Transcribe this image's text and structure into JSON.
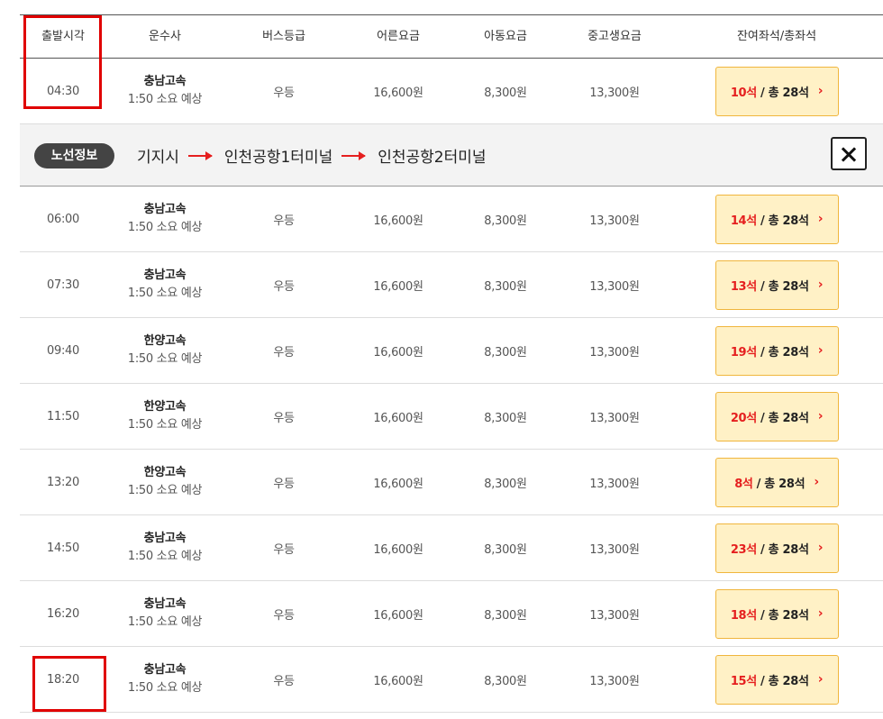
{
  "headers": {
    "time": "출발시각",
    "company": "운수사",
    "grade": "버스등급",
    "adult": "어른요금",
    "child": "아동요금",
    "teen": "중고생요금",
    "seats": "잔여좌석/총좌석"
  },
  "route_info": {
    "label": "노선정보",
    "stops": [
      "기지시",
      "인천공항1터미널",
      "인천공항2터미널"
    ]
  },
  "seat_suffix": "석",
  "total_prefix": "/ 총 ",
  "rows": [
    {
      "time": "04:30",
      "company": "충남고속",
      "duration": "1:50 소요 예상",
      "grade": "우등",
      "adult": "16,600원",
      "child": "8,300원",
      "teen": "13,300원",
      "remaining": "10석",
      "total": "/ 총 28석"
    },
    {
      "time": "06:00",
      "company": "충남고속",
      "duration": "1:50 소요 예상",
      "grade": "우등",
      "adult": "16,600원",
      "child": "8,300원",
      "teen": "13,300원",
      "remaining": "14석",
      "total": "/ 총 28석"
    },
    {
      "time": "07:30",
      "company": "충남고속",
      "duration": "1:50 소요 예상",
      "grade": "우등",
      "adult": "16,600원",
      "child": "8,300원",
      "teen": "13,300원",
      "remaining": "13석",
      "total": "/ 총 28석"
    },
    {
      "time": "09:40",
      "company": "한양고속",
      "duration": "1:50 소요 예상",
      "grade": "우등",
      "adult": "16,600원",
      "child": "8,300원",
      "teen": "13,300원",
      "remaining": "19석",
      "total": "/ 총 28석"
    },
    {
      "time": "11:50",
      "company": "한양고속",
      "duration": "1:50 소요 예상",
      "grade": "우등",
      "adult": "16,600원",
      "child": "8,300원",
      "teen": "13,300원",
      "remaining": "20석",
      "total": "/ 총 28석"
    },
    {
      "time": "13:20",
      "company": "한양고속",
      "duration": "1:50 소요 예상",
      "grade": "우등",
      "adult": "16,600원",
      "child": "8,300원",
      "teen": "13,300원",
      "remaining": "8석",
      "total": "/ 총 28석"
    },
    {
      "time": "14:50",
      "company": "충남고속",
      "duration": "1:50 소요 예상",
      "grade": "우등",
      "adult": "16,600원",
      "child": "8,300원",
      "teen": "13,300원",
      "remaining": "23석",
      "total": "/ 총 28석"
    },
    {
      "time": "16:20",
      "company": "충남고속",
      "duration": "1:50 소요 예상",
      "grade": "우등",
      "adult": "16,600원",
      "child": "8,300원",
      "teen": "13,300원",
      "remaining": "18석",
      "total": "/ 총 28석"
    },
    {
      "time": "18:20",
      "company": "충남고속",
      "duration": "1:50 소요 예상",
      "grade": "우등",
      "adult": "16,600원",
      "child": "8,300원",
      "teen": "13,300원",
      "remaining": "15석",
      "total": "/ 총 28석"
    }
  ],
  "colors": {
    "accent": "#e51f1f",
    "seat_bg": "#fff1c6",
    "seat_border": "#f0b63d",
    "highlight": "#e00000"
  },
  "icons": {
    "close": "close-icon",
    "chevron": "chevron-right-icon",
    "arrow": "arrow-right-icon"
  }
}
